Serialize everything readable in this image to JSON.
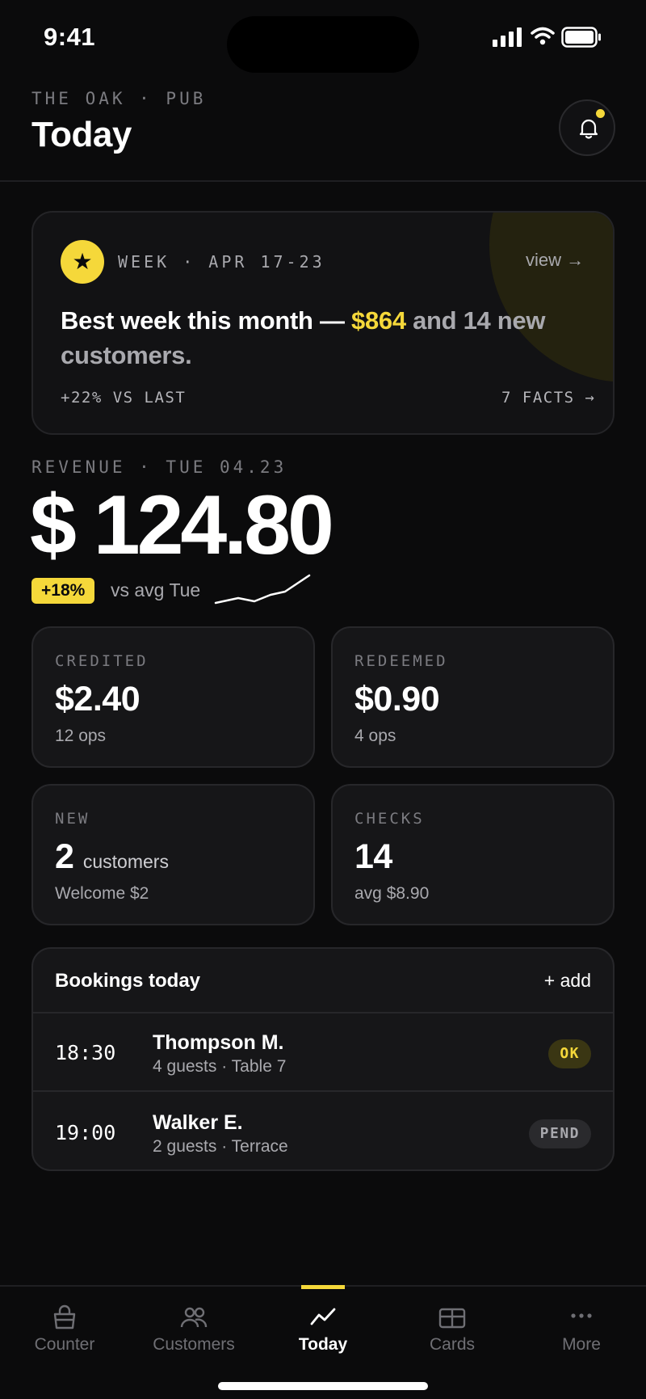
{
  "status_bar": {
    "time": "9:41"
  },
  "header": {
    "eyebrow": "THE OAK · PUB",
    "title": "Today"
  },
  "highlight": {
    "week": "WEEK · APR 17-23",
    "view": "view →",
    "headline_pre": "Best week this month — ",
    "headline_amount": "$864",
    "headline_post": " and 14 new customers.",
    "delta": "+22% VS LAST",
    "facts": "7 FACTS →"
  },
  "revenue": {
    "label": "REVENUE · TUE 04.23",
    "amount": "$ 124.80",
    "badge": "+18%",
    "comparison": "vs avg Tue"
  },
  "tiles": [
    {
      "label": "CREDITED",
      "value": "$2.40",
      "unit": "",
      "sub": "12 ops"
    },
    {
      "label": "REDEEMED",
      "value": "$0.90",
      "unit": "",
      "sub": "4 ops"
    },
    {
      "label": "NEW",
      "value": "2",
      "unit": "customers",
      "sub": "Welcome $2"
    },
    {
      "label": "CHECKS",
      "value": "14",
      "unit": "",
      "sub": "avg $8.90"
    }
  ],
  "bookings": {
    "title": "Bookings today",
    "add": "+ add",
    "rows": [
      {
        "time": "18:30",
        "name": "Thompson M.",
        "detail": "4 guests · Table 7",
        "status": "OK"
      },
      {
        "time": "19:00",
        "name": "Walker E.",
        "detail": "2 guests · Terrace",
        "status": "PEND"
      }
    ]
  },
  "tabs": [
    {
      "label": "Counter",
      "icon": "bag-icon"
    },
    {
      "label": "Customers",
      "icon": "people-icon"
    },
    {
      "label": "Today",
      "icon": "trend-icon",
      "active": true
    },
    {
      "label": "Cards",
      "icon": "cards-icon"
    },
    {
      "label": "More",
      "icon": "more-icon"
    }
  ],
  "colors": {
    "accent": "#f5d83a",
    "background": "#0b0b0c",
    "surface": "#161618"
  }
}
